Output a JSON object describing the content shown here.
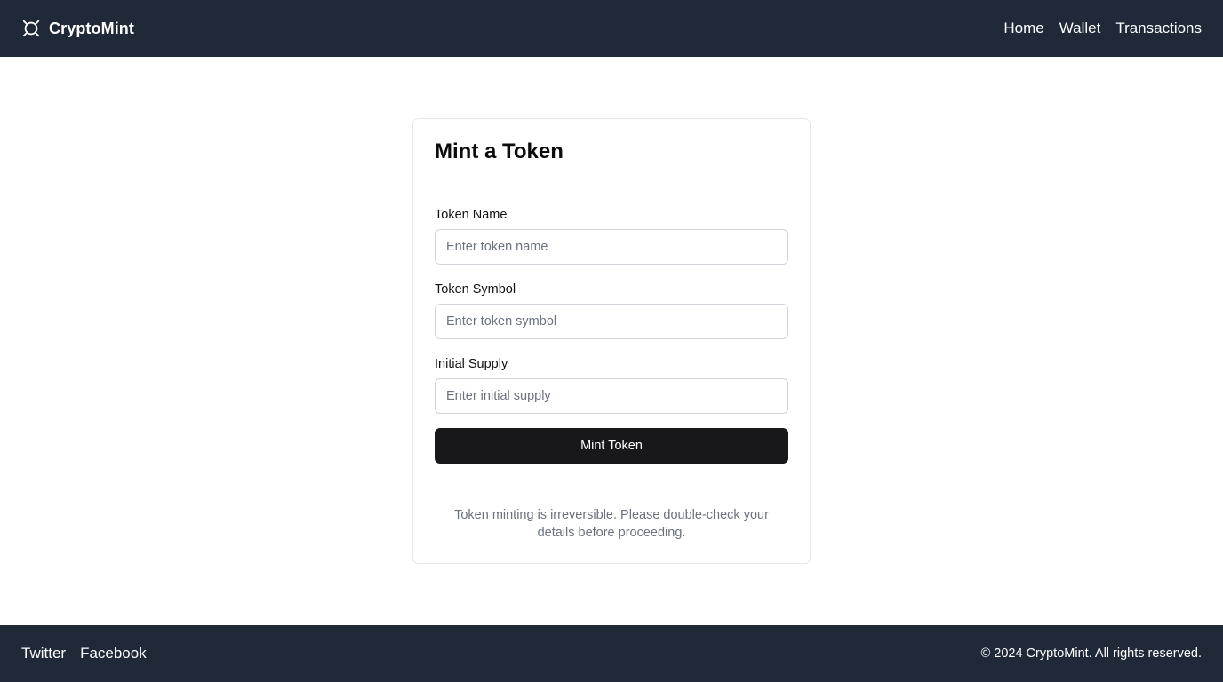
{
  "header": {
    "brand_name": "CryptoMint",
    "brand_icon": "token-icon",
    "nav": [
      {
        "label": "Home"
      },
      {
        "label": "Wallet"
      },
      {
        "label": "Transactions"
      }
    ]
  },
  "form": {
    "title": "Mint a Token",
    "fields": [
      {
        "label": "Token Name",
        "value": "",
        "placeholder": "Enter token name"
      },
      {
        "label": "Token Symbol",
        "value": "",
        "placeholder": "Enter token symbol"
      },
      {
        "label": "Initial Supply",
        "value": "",
        "placeholder": "Enter initial supply"
      }
    ],
    "submit_label": "Mint Token",
    "notice": "Token minting is irreversible. Please double-check your details before proceeding."
  },
  "footer": {
    "links": [
      {
        "label": "Twitter"
      },
      {
        "label": "Facebook"
      }
    ],
    "copyright": "© 2024 CryptoMint. All rights reserved."
  },
  "colors": {
    "nav_background": "#1f2937",
    "button_background": "#18181b",
    "muted_text": "#6b7280",
    "border": "#d1d5db"
  }
}
